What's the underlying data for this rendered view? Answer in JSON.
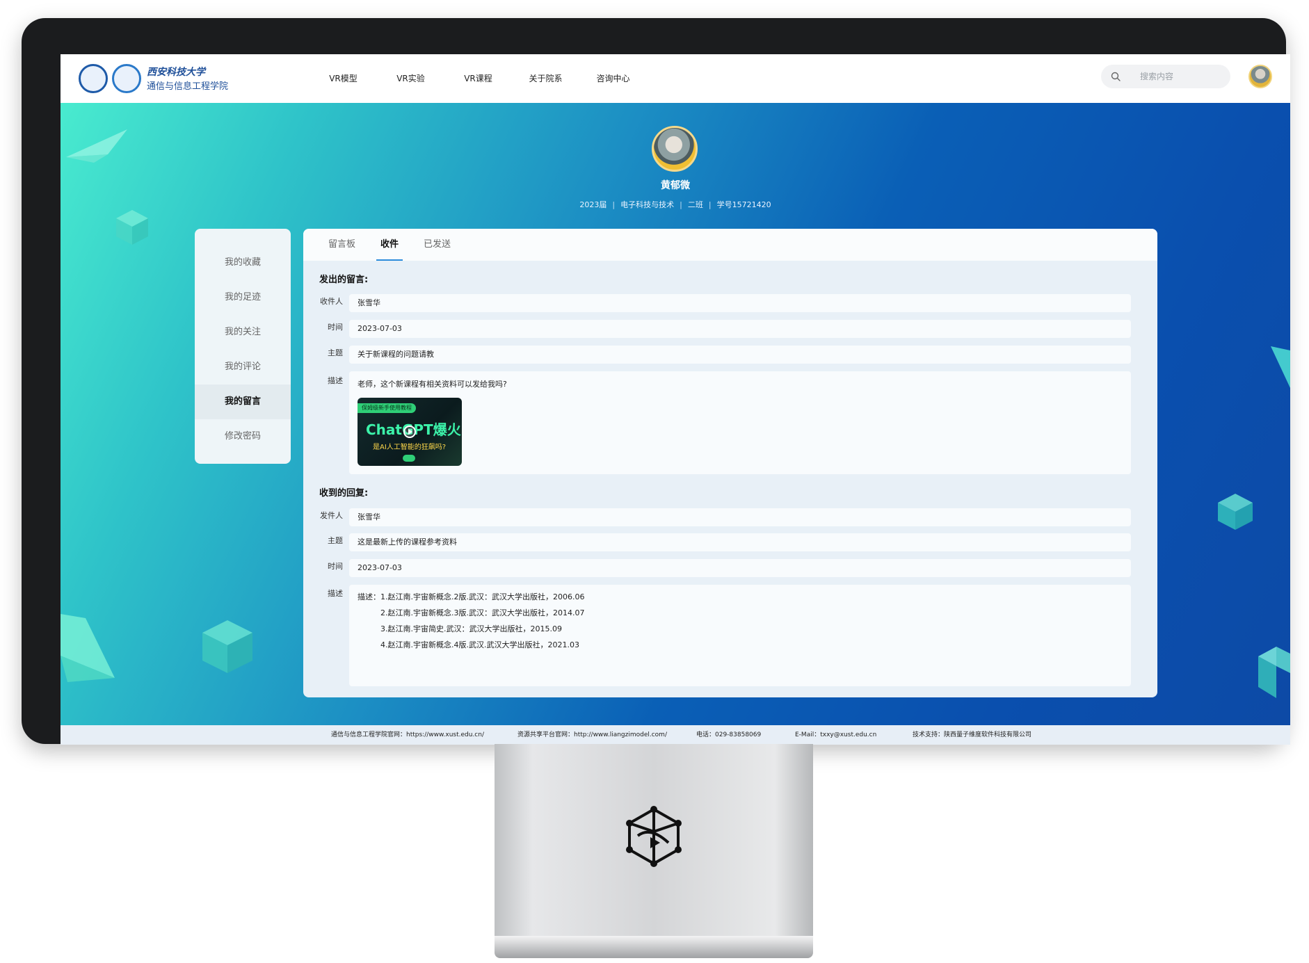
{
  "header": {
    "logo": {
      "school_name": "西安科技大学",
      "college_name": "通信与信息工程学院"
    },
    "nav": [
      "VR模型",
      "VR实验",
      "VR课程",
      "关于院系",
      "咨询中心"
    ],
    "search": {
      "placeholder": "搜索内容",
      "icon": "search-icon"
    }
  },
  "profile": {
    "name": "黄郁微",
    "grade": "2023届",
    "major": "电子科技与技术",
    "class": "二班",
    "student_id": "学号15721420"
  },
  "side_menu": {
    "items": [
      "我的收藏",
      "我的足迹",
      "我的关注",
      "我的评论",
      "我的留言",
      "修改密码"
    ],
    "active": "我的留言"
  },
  "tabs": {
    "items": [
      "留言板",
      "收件",
      "已发送"
    ],
    "active": "收件"
  },
  "sent_message": {
    "section_title": "发出的留言:",
    "recipient_label": "收件人",
    "recipient": "张雪华",
    "time_label": "时间",
    "time": "2023-07-03",
    "subject_label": "主题",
    "subject": "关于新课程的问题请教",
    "desc_label": "描述",
    "desc": "老师，这个新课程有相关资料可以发给我吗?",
    "attachment": {
      "tag": "保姆级新手使用教程",
      "title": "ChatGPT爆火",
      "subtitle": "是AI人工智能的狂飙吗?"
    }
  },
  "reply": {
    "section_title": "收到的回复:",
    "sender_label": "发件人",
    "sender": "张雪华",
    "subject_label": "主题",
    "subject": "这是最新上传的课程参考资料",
    "time_label": "时间",
    "time": "2023-07-03",
    "desc_label": "描述",
    "desc_lines": [
      "描述：1.赵江南.宇宙新概念.2版.武汉：武汉大学出版社，2006.06",
      "2.赵江南.宇宙新概念.3版.武汉：武汉大学出版社，2014.07",
      "3.赵江南.宇宙简史.武汉：武汉大学出版社，2015.09",
      "4.赵江南.宇宙新概念.4版.武汉.武汉大学出版社，2021.03"
    ]
  },
  "footer": {
    "college_site": "通信与信息工程学院官网：https://www.xust.edu.cn/",
    "resource_site": "资源共享平台官网：http://www.liangzimodel.com/",
    "phone": "电话：029-83858069",
    "email": "E-Mail：txxy@xust.edu.cn",
    "support": "技术支持：陕西量子维度软件科技有限公司"
  },
  "colors": {
    "accent": "#2c8cdb",
    "hero_start": "#49ebcf",
    "hero_end": "#0d4aa6"
  }
}
